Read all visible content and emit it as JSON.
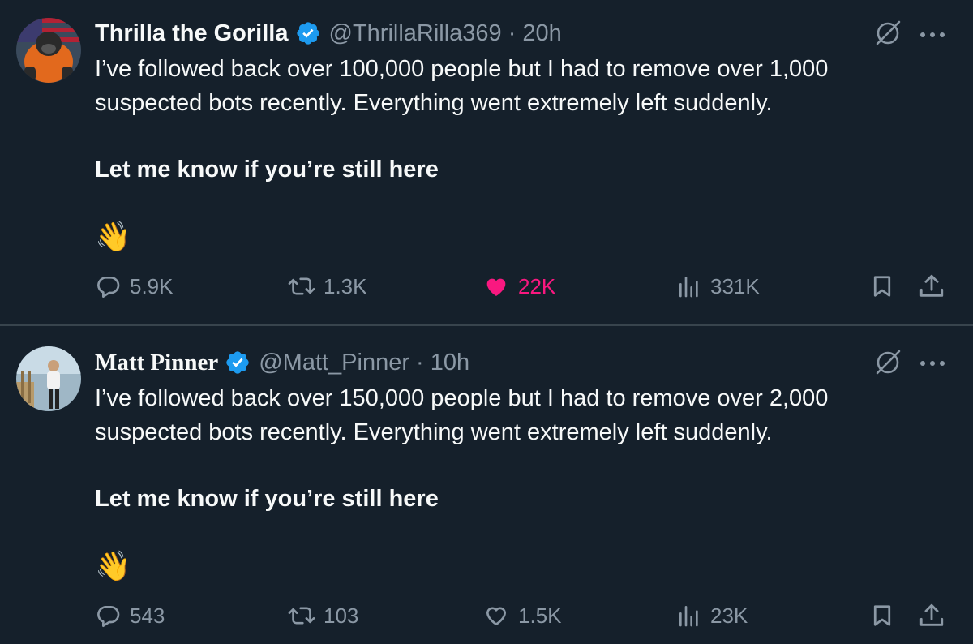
{
  "tweets": [
    {
      "name": "Thrilla the Gorilla",
      "handle": "@ThrillaRilla369",
      "separator": "·",
      "time": "20h",
      "text_line": "I’ve followed back over 100,000 people but I had to remove over 1,000 suspected bots recently. Everything went extremely left suddenly.",
      "text_bold": "Let me know if you’re still here",
      "emoji": "👋",
      "replies": "5.9K",
      "retweets": "1.3K",
      "likes": "22K",
      "liked": true,
      "views": "331K"
    },
    {
      "name": "Matt Pinner",
      "handle": "@Matt_Pinner",
      "separator": "·",
      "time": "10h",
      "text_line": "I’ve followed back over 150,000 people but I had to remove over 2,000 suspected bots recently. Everything went extremely left suddenly.",
      "text_bold": "Let me know if you’re still here",
      "emoji": "👋",
      "replies": "543",
      "retweets": "103",
      "likes": "1.5K",
      "liked": false,
      "views": "23K"
    }
  ],
  "icons": [
    "verified-badge-icon",
    "grok-icon",
    "more-icon",
    "reply-icon",
    "retweet-icon",
    "heart-icon",
    "views-icon",
    "bookmark-icon",
    "share-icon"
  ],
  "colors": {
    "background": "#15202b",
    "text": "#f7f9f9",
    "muted": "#8b98a5",
    "verified": "#1d9bf0",
    "like": "#f91880",
    "divider": "#38444d"
  }
}
